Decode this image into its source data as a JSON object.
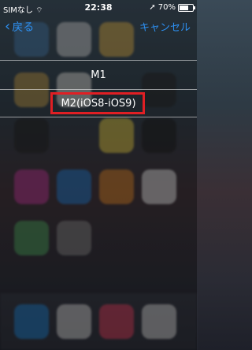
{
  "status_bar": {
    "carrier": "SIMなし",
    "time": "22:38",
    "battery": "70%",
    "battery_level": 0.7
  },
  "nav": {
    "back_label": "戻る",
    "cancel_label": "キャンセル"
  },
  "options": [
    {
      "label": "M1"
    },
    {
      "label": "M2(iOS8-iOS9)"
    }
  ],
  "colors": {
    "accent": "#2d8ff0",
    "highlight_border": "#e01f24"
  }
}
